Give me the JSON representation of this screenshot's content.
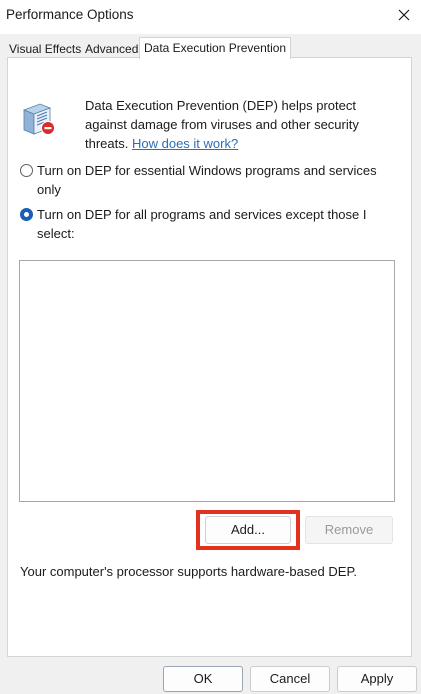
{
  "window": {
    "title": "Performance Options"
  },
  "tabs": [
    {
      "label": "Visual Effects",
      "active": false
    },
    {
      "label": "Advanced",
      "active": false
    },
    {
      "label": "Data Execution Prevention",
      "active": true
    }
  ],
  "dep": {
    "description": "Data Execution Prevention (DEP) helps protect against damage from viruses and other security threats.",
    "link_text": "How does it work?",
    "icon": "dep-shield-document-icon",
    "options": [
      {
        "label": "Turn on DEP for essential Windows programs and services only",
        "checked": false
      },
      {
        "label": "Turn on DEP for all programs and services except those I select:",
        "checked": true
      }
    ],
    "add_label": "Add...",
    "remove_label": "Remove",
    "support_text": "Your computer's processor supports hardware-based DEP."
  },
  "footer": {
    "ok_label": "OK",
    "cancel_label": "Cancel",
    "apply_label": "Apply"
  },
  "colors": {
    "accent": "#1a5fb4",
    "link": "#2a6fb9",
    "highlight": "#e2321d"
  }
}
